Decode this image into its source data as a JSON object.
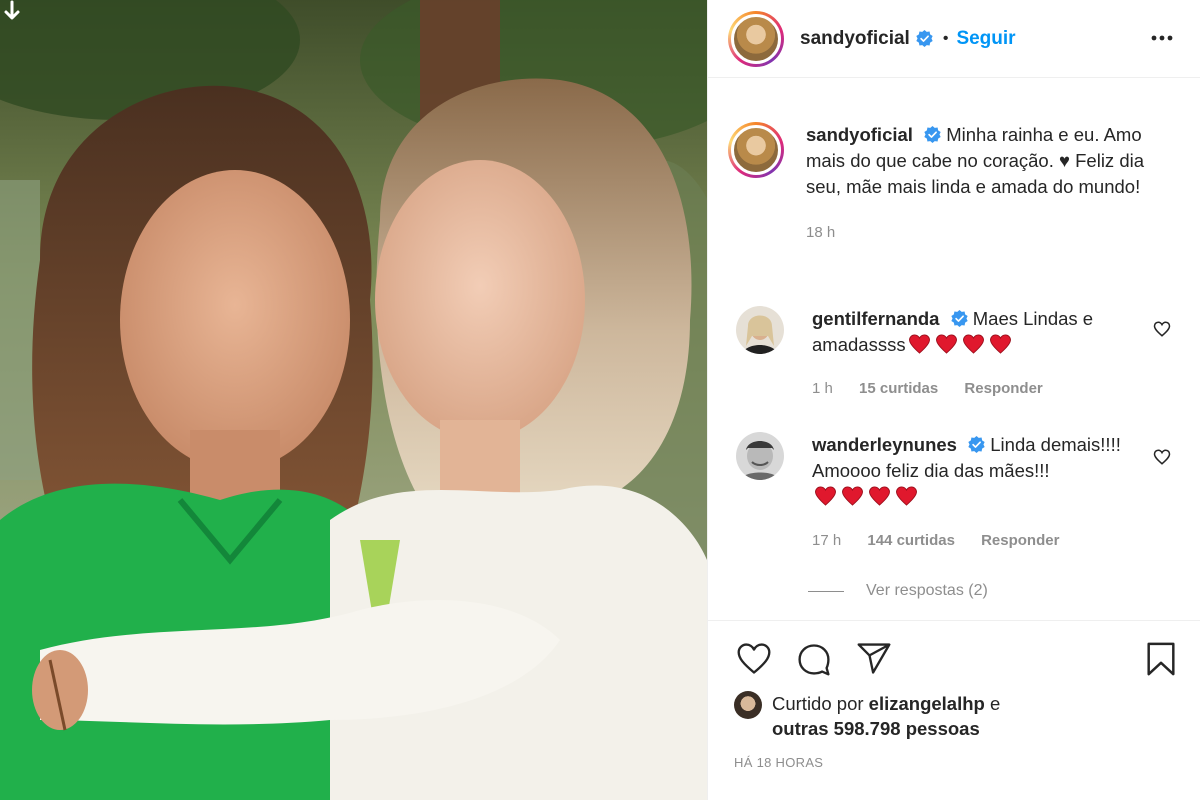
{
  "post": {
    "author": "sandyoficial",
    "follow_label": "Seguir",
    "separator": "•",
    "caption": "Minha rainha e eu. Amo mais do que cabe no coração. ♥ Feliz dia seu, mãe mais linda e amada do mundo!",
    "caption_time": "18 h"
  },
  "comments": [
    {
      "user": "gentilfernanda",
      "text": "Maes Lindas e amadassss",
      "hearts": 4,
      "time": "1 h",
      "likes": "15 curtidas",
      "reply": "Responder"
    },
    {
      "user": "wanderleynunes",
      "text": "Linda demais!!!! Amoooo feliz dia das mães!!!",
      "hearts": 4,
      "time": "17 h",
      "likes": "144 curtidas",
      "reply": "Responder"
    }
  ],
  "view_replies": "Ver respostas (2)",
  "likes_line": {
    "prefix": "Curtido por ",
    "user": "elizangelalhp",
    "middle": " e",
    "rest": "outras 598.798 pessoas"
  },
  "time_ago": "HÁ 18 HORAS",
  "icons": {
    "like": "heart-outline-icon",
    "comment": "comment-bubble-icon",
    "share": "paper-plane-icon",
    "save": "bookmark-icon",
    "verified": "verified-badge-icon",
    "more": "ellipsis-icon",
    "download": "download-arrow-icon"
  },
  "colors": {
    "link_blue": "#0095f6",
    "verified_blue": "#3897f0",
    "muted_gray": "#8e8e8e",
    "heart_red": "#e0182d",
    "shirt_green": "#21b04b"
  }
}
